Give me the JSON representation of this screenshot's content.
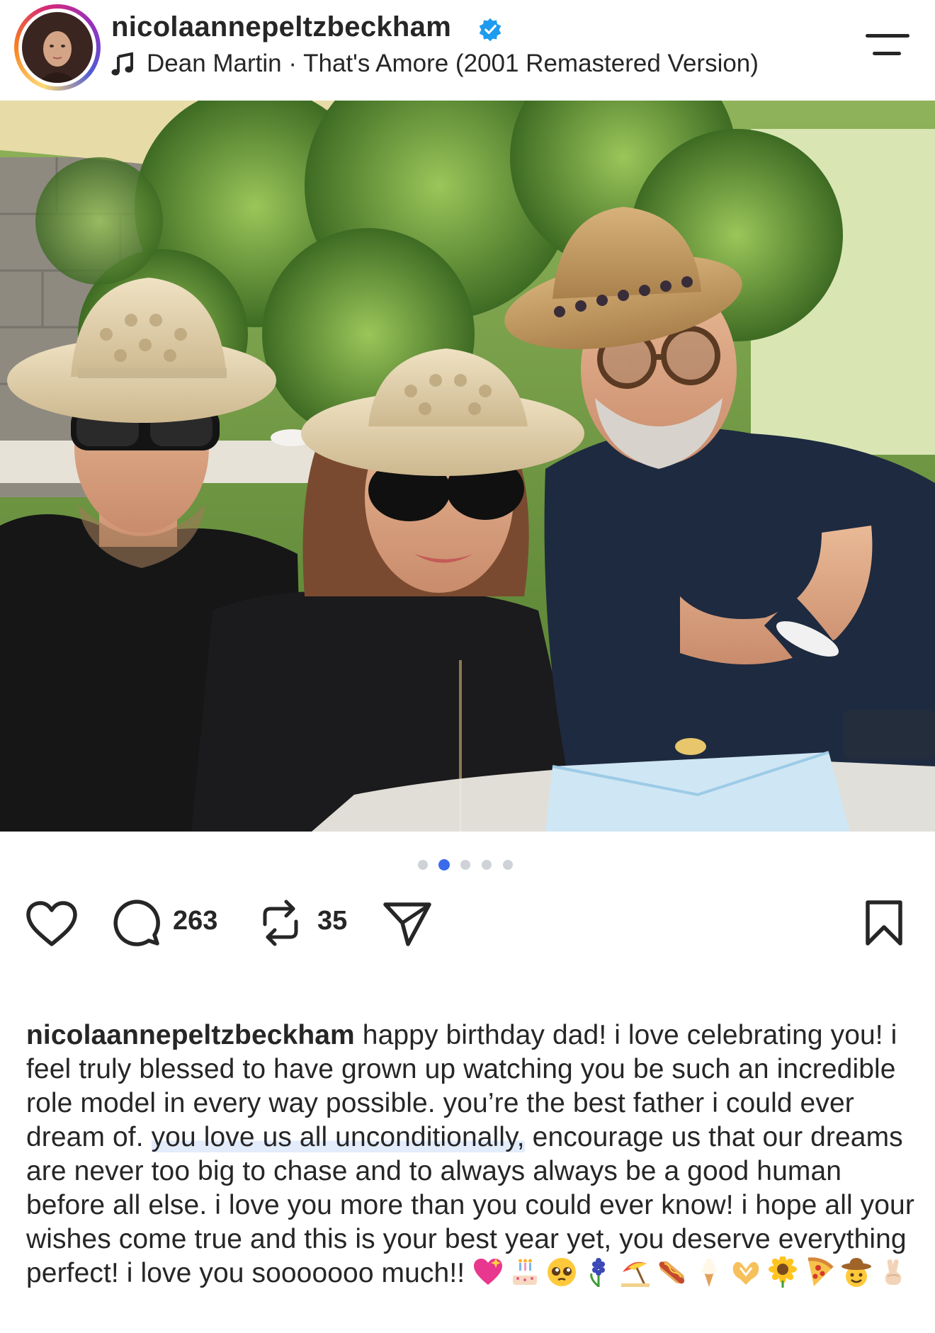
{
  "header": {
    "username": "nicolaannepeltzbeckham",
    "audio": "Dean Martin · That's Amore (2001 Remastered Version)",
    "verified": true
  },
  "carousel": {
    "slide_count": 5,
    "active_index": 1
  },
  "actions": {
    "comment_count": "263",
    "repost_count": "35"
  },
  "caption": {
    "username": "nicolaannepeltzbeckham",
    "text_1": " happy birthday dad! i love celebrating you! i feel truly blessed to have grown up watching you be such an incredible role model in every way possible. you’re the best father i could ever dream of. ",
    "highlight": "you love us all unconditionally,",
    "text_2": " encourage us that our dreams are never too big to chase and to always always be a good human before all else. i love you more than you could ever know! i hope all your wishes come true and this is your best year yet, you deserve everything perfect! i love you sooooooo much!! ",
    "emojis": [
      "sparkling-heart",
      "birthday-cake",
      "pleading-face",
      "hyacinth",
      "beach-umbrella",
      "hot-dog",
      "soft-ice-cream",
      "heart-hands",
      "sunflower",
      "pizza",
      "cowboy-face",
      "crossed-fingers"
    ]
  },
  "colors": {
    "accent_blue": "#3a6bea",
    "verified_blue": "#1d9bf0",
    "text": "#262626"
  }
}
